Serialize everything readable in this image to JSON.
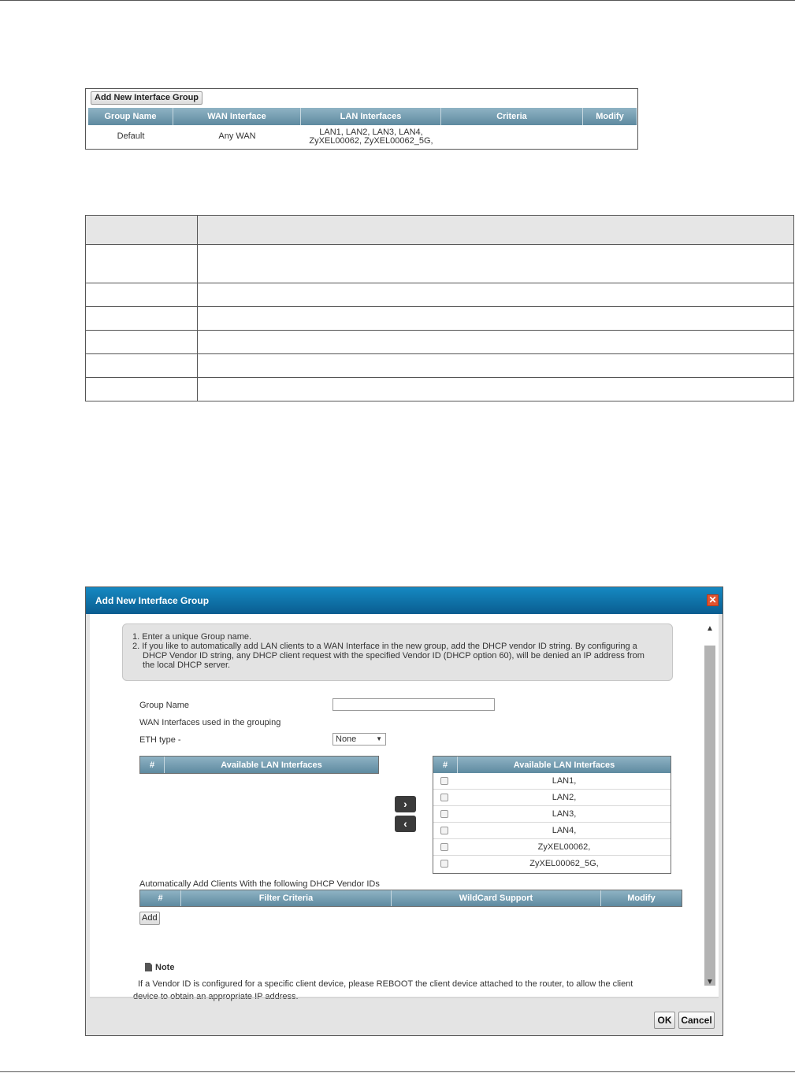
{
  "group_list": {
    "add_button": "Add New Interface Group",
    "columns": [
      "Group Name",
      "WAN Interface",
      "LAN Interfaces",
      "Criteria",
      "Modify"
    ],
    "rows": [
      {
        "group_name": "Default",
        "wan_interface": "Any WAN",
        "lan_line1": "LAN1, LAN2, LAN3, LAN4,",
        "lan_line2": "ZyXEL00062, ZyXEL00062_5G,",
        "criteria": "",
        "modify": ""
      }
    ]
  },
  "dialog": {
    "title": "Add New Interface Group",
    "close_symbol": "✕",
    "instructions": {
      "line1": "1. Enter a unique Group name.",
      "line2": "2. If you like to automatically add LAN clients to a WAN Interface in the new group, add the DHCP vendor ID string. By configuring a",
      "line3": "DHCP Vendor ID string, any DHCP client request with the specified Vendor ID (DHCP option 60), will be denied an IP address from",
      "line4": "the local DHCP server."
    },
    "group_name_label": "Group Name",
    "group_name_value": "",
    "wan_label": "WAN Interfaces used in the grouping",
    "eth_type_label": "ETH type -",
    "eth_type_selected": "None",
    "left_list": {
      "col_num": "#",
      "col_name": "Available LAN Interfaces",
      "items": []
    },
    "right_list": {
      "col_num": "#",
      "col_name": "Available LAN Interfaces",
      "items": [
        "LAN1,",
        "LAN2,",
        "LAN3,",
        "LAN4,",
        "ZyXEL00062,",
        "ZyXEL00062_5G,"
      ]
    },
    "move_right_symbol": "›",
    "move_left_symbol": "‹",
    "vendor_section_label": "Automatically Add Clients With the following DHCP Vendor IDs",
    "vendor_columns": [
      "#",
      "Filter Criteria",
      "WildCard Support",
      "Modify"
    ],
    "add_button": "Add",
    "note_title": "Note",
    "note_line1": "If a Vendor ID is configured for a specific client device, please REBOOT the client device attached to the router, to allow the client",
    "note_line2": "device to obtain an appropriate IP address.",
    "ok_button": "OK",
    "cancel_button": "Cancel"
  }
}
